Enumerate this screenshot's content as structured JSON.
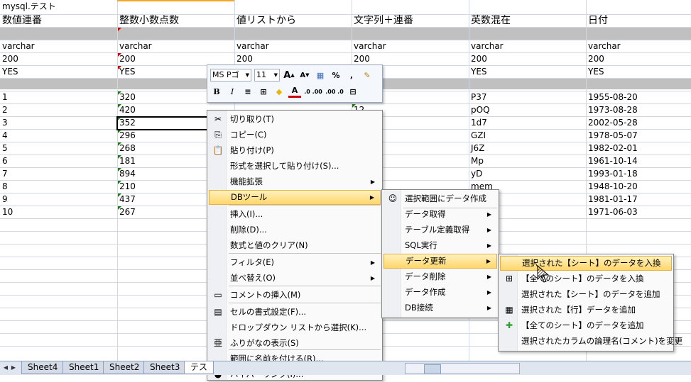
{
  "sheet": {
    "table_name": "mysql.テスト",
    "columns": [
      {
        "header": "数値連番",
        "type": "varchar",
        "length": "200",
        "nullable": "YES"
      },
      {
        "header": "整数小数点数",
        "type": "varchar",
        "length": "200",
        "nullable": "YES"
      },
      {
        "header": "値リストから",
        "type": "varchar",
        "length": "200",
        "nullable": "YES"
      },
      {
        "header": "文字列＋連番",
        "type": "varchar",
        "length": "200",
        "nullable": "YES"
      },
      {
        "header": "英数混在",
        "type": "varchar",
        "length": "200",
        "nullable": "YES"
      },
      {
        "header": "日付",
        "type": "varchar",
        "length": "200",
        "nullable": "YES"
      }
    ],
    "rows": [
      [
        "1",
        "320",
        "",
        "",
        "P37",
        "1955-08-20"
      ],
      [
        "2",
        "420",
        "",
        "12",
        "pOQ",
        "1973-08-28"
      ],
      [
        "3",
        "352",
        "",
        "",
        "1d7",
        "2002-05-28"
      ],
      [
        "4",
        "296",
        "",
        "",
        "GZI",
        "1978-05-07"
      ],
      [
        "5",
        "268",
        "",
        "",
        "J6Z",
        "1982-02-01"
      ],
      [
        "6",
        "181",
        "",
        "",
        "Mp",
        "1961-10-14"
      ],
      [
        "7",
        "894",
        "",
        "",
        "yD",
        "1993-01-18"
      ],
      [
        "8",
        "210",
        "",
        "",
        "mem",
        "1948-10-20"
      ],
      [
        "9",
        "437",
        "",
        "",
        "",
        "1981-01-17"
      ],
      [
        "10",
        "267",
        "",
        "",
        "",
        "1971-06-03"
      ]
    ]
  },
  "mini_toolbar": {
    "font_name": "MS Pゴ",
    "font_size": "11",
    "grow_font": "A",
    "shrink_font": "A",
    "percent": "%",
    "comma": ",",
    "bold": "B",
    "italic": "I",
    "font_color_label": "A",
    "inc_decimal": ".0 .00",
    "dec_decimal": ".00 .0"
  },
  "context_menu": [
    {
      "label": "切り取り(T)",
      "icon": "scissors-icon",
      "glyph": "✂"
    },
    {
      "label": "コピー(C)",
      "icon": "copy-icon",
      "glyph": "⎘"
    },
    {
      "label": "貼り付け(P)",
      "icon": "paste-icon",
      "glyph": "📋"
    },
    {
      "label": "形式を選択して貼り付け(S)..."
    },
    {
      "label": "機能拡張",
      "submenu": true
    },
    {
      "label": "DBツール",
      "submenu": true,
      "highlighted": true
    },
    {
      "label": "挿入(I)..."
    },
    {
      "label": "削除(D)..."
    },
    {
      "label": "数式と値のクリア(N)"
    },
    {
      "label": "フィルタ(E)",
      "submenu": true
    },
    {
      "label": "並べ替え(O)",
      "submenu": true
    },
    {
      "label": "コメントの挿入(M)",
      "icon": "comment-icon",
      "glyph": "▭"
    },
    {
      "label": "セルの書式設定(F)...",
      "icon": "format-cells-icon",
      "glyph": "▤"
    },
    {
      "label": "ドロップダウン リストから選択(K)..."
    },
    {
      "label": "ふりがなの表示(S)",
      "icon": "furigana-icon",
      "glyph": "亜"
    },
    {
      "label": "範囲に名前を付ける(R)..."
    },
    {
      "label": "ハイパーリンク(I)...",
      "icon": "hyperlink-icon",
      "glyph": "●"
    }
  ],
  "db_submenu": [
    {
      "label": "選択範囲にデータ作成",
      "icon": "smiley-icon",
      "glyph": "☺"
    },
    {
      "label": "データ取得",
      "submenu": true
    },
    {
      "label": "テーブル定義取得",
      "submenu": true
    },
    {
      "label": "SQL実行",
      "submenu": true
    },
    {
      "label": "データ更新",
      "submenu": true,
      "highlighted": true
    },
    {
      "label": "データ削除",
      "submenu": true
    },
    {
      "label": "データ作成",
      "submenu": true
    },
    {
      "label": "DB接続",
      "submenu": true
    }
  ],
  "update_submenu": [
    {
      "label": "選択された【シート】のデータを入換",
      "highlighted": true
    },
    {
      "label": "【全てのシート】のデータを入換",
      "icon": "replace-all-icon",
      "glyph": "⊞"
    },
    {
      "label": "選択された【シート】のデータを追加"
    },
    {
      "label": "選択された【行】データを追加",
      "icon": "add-row-icon",
      "glyph": "▦"
    },
    {
      "label": "【全てのシート】のデータを追加",
      "icon": "add-all-icon",
      "glyph": "✚"
    },
    {
      "label": "選択されたカラムの論理名(コメント)を変更"
    }
  ],
  "tabs": [
    "Sheet4",
    "Sheet1",
    "Sheet2",
    "Sheet3",
    "テス"
  ],
  "colors": {
    "highlight_top": "#fff1bf",
    "highlight_bottom": "#ffd66b",
    "header_gray": "#c0c0c0",
    "grid": "#d0d7e5",
    "comment_marker": "#c00000",
    "error_marker": "#1f7a1f",
    "plus_icon": "#2a9d2a"
  }
}
